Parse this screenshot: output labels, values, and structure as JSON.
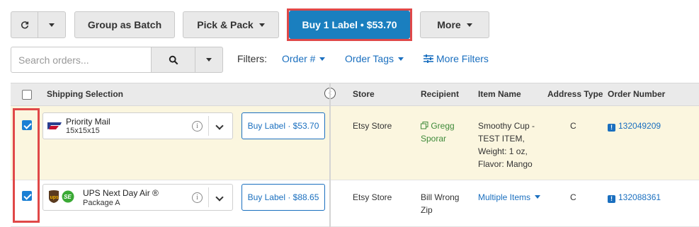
{
  "toolbar": {
    "group_batch": "Group as Batch",
    "pick_pack": "Pick & Pack",
    "buy_label": "Buy 1 Label • $53.70",
    "more": "More"
  },
  "search": {
    "placeholder": "Search orders...",
    "value": ""
  },
  "filters": {
    "label": "Filters:",
    "order_num": "Order #",
    "order_tags": "Order Tags",
    "more_filters": "More Filters"
  },
  "table": {
    "headers": {
      "shipping": "Shipping Selection",
      "store": "Store",
      "recipient": "Recipient",
      "item": "Item Name",
      "address": "Address Type",
      "order": "Order Number"
    },
    "rows": [
      {
        "service": "Priority Mail",
        "package": "15x15x15",
        "buy": "Buy Label · $53.70",
        "store": "Etsy Store",
        "recipient_line1": "Gregg",
        "recipient_line2": "Sporar",
        "item_lines": [
          "Smoothy Cup -",
          "TEST ITEM,",
          "Weight: 1 oz,",
          "Flavor: Mango"
        ],
        "address": "C",
        "order": "132049209",
        "checked": true
      },
      {
        "service": "UPS Next Day Air ®",
        "package": "Package A",
        "buy": "Buy Label · $88.65",
        "store": "Etsy Store",
        "recipient_line1": "Bill Wrong",
        "recipient_line2": "Zip",
        "item": "Multiple Items",
        "address": "C",
        "order": "132088361",
        "checked": true
      }
    ]
  },
  "colors": {
    "primary": "#1a7fbf",
    "link": "#1a6fbf",
    "highlight_row": "#fbf6df",
    "annotation": "#e04848"
  },
  "icons": [
    "refresh-icon",
    "caret-down-icon",
    "search-icon",
    "sliders-icon",
    "info-icon",
    "chevron-down-icon",
    "usps-logo",
    "ups-logo",
    "flag-icon",
    "copy-icon"
  ]
}
